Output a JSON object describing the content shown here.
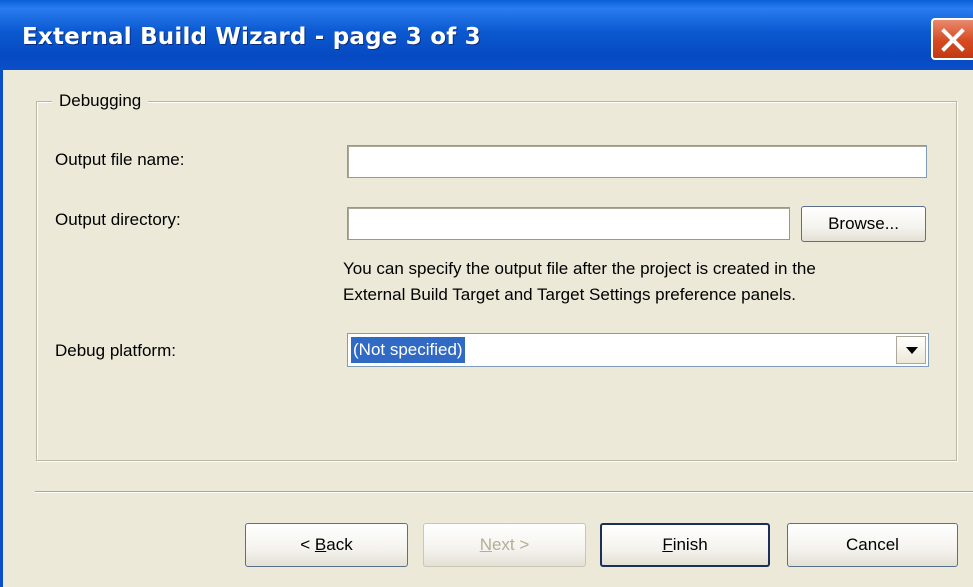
{
  "window": {
    "title": "External Build Wizard - page 3 of 3"
  },
  "group": {
    "legend": "Debugging"
  },
  "fields": {
    "output_file_label": "Output file name:",
    "output_file_value": "",
    "output_dir_label": "Output directory:",
    "output_dir_value": "",
    "browse_label": "Browse...",
    "hint_line1": "You can specify the output file after the project is created in the",
    "hint_line2": "External Build Target and Target Settings preference panels.",
    "platform_label": "Debug platform:",
    "platform_value": "(Not specified)"
  },
  "buttons": {
    "back_prefix": "< ",
    "back_mnemonic": "B",
    "back_rest": "ack",
    "next_mnemonic": "N",
    "next_rest": "ext >",
    "finish_mnemonic": "F",
    "finish_rest": "inish",
    "cancel": "Cancel"
  },
  "icons": {
    "close": "close-icon",
    "dropdown": "chevron-down-icon"
  },
  "colors": {
    "titlebar": "#0b59d0",
    "close": "#d64a22",
    "selection": "#316ac5",
    "face": "#ece9d8"
  }
}
